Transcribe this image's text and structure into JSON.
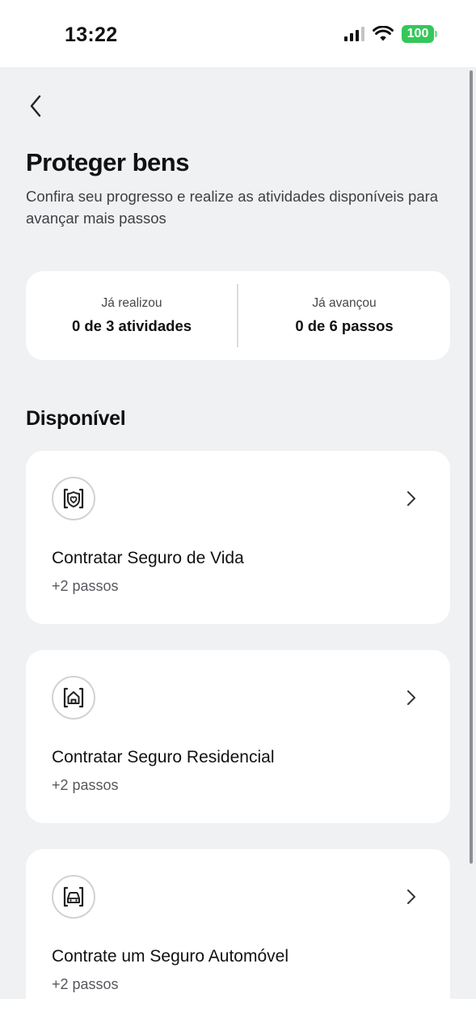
{
  "status_bar": {
    "time": "13:22",
    "battery": "100",
    "icons": [
      "cellular-signal-icon",
      "wifi-icon",
      "battery-icon"
    ]
  },
  "header": {
    "back_icon": "chevron-left-icon",
    "title": "Proteger bens",
    "subtitle": "Confira seu progresso e realize as atividades disponíveis para avançar mais passos"
  },
  "progress": {
    "done_label": "Já realizou",
    "done_value": "0 de 3 atividades",
    "advanced_label": "Já avançou",
    "advanced_value": "0 de 6 passos"
  },
  "available": {
    "section_title": "Disponível",
    "items": [
      {
        "icon": "heart-shield-icon",
        "title": "Contratar Seguro de Vida",
        "steps": "+2 passos"
      },
      {
        "icon": "home-icon",
        "title": "Contratar Seguro Residencial",
        "steps": "+2 passos"
      },
      {
        "icon": "car-icon",
        "title": "Contrate um Seguro Automóvel",
        "steps": "+2 passos"
      }
    ]
  },
  "colors": {
    "background": "#f0f1f3",
    "card": "#ffffff",
    "battery": "#34c759",
    "text_primary": "#111111",
    "text_secondary": "#55585c"
  }
}
